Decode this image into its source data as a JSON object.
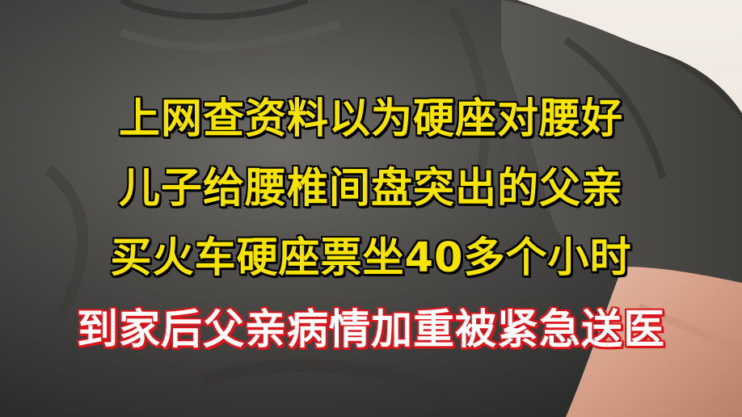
{
  "video_frame": {
    "captions": [
      {
        "text": "上网查资料以为硬座对腰好",
        "style": "yellow"
      },
      {
        "text": "儿子给腰椎间盘突出的父亲",
        "style": "yellow"
      },
      {
        "text": "买火车硬座票坐40多个小时",
        "style": "yellow"
      },
      {
        "text": "到家后父亲病情加重被紧急送医",
        "style": "white-red"
      }
    ]
  },
  "colors": {
    "caption_yellow": "#f6e400",
    "caption_red_outline": "#d9161c",
    "shirt_gray": "#4a4a48",
    "skin_tone": "#d9a890"
  }
}
